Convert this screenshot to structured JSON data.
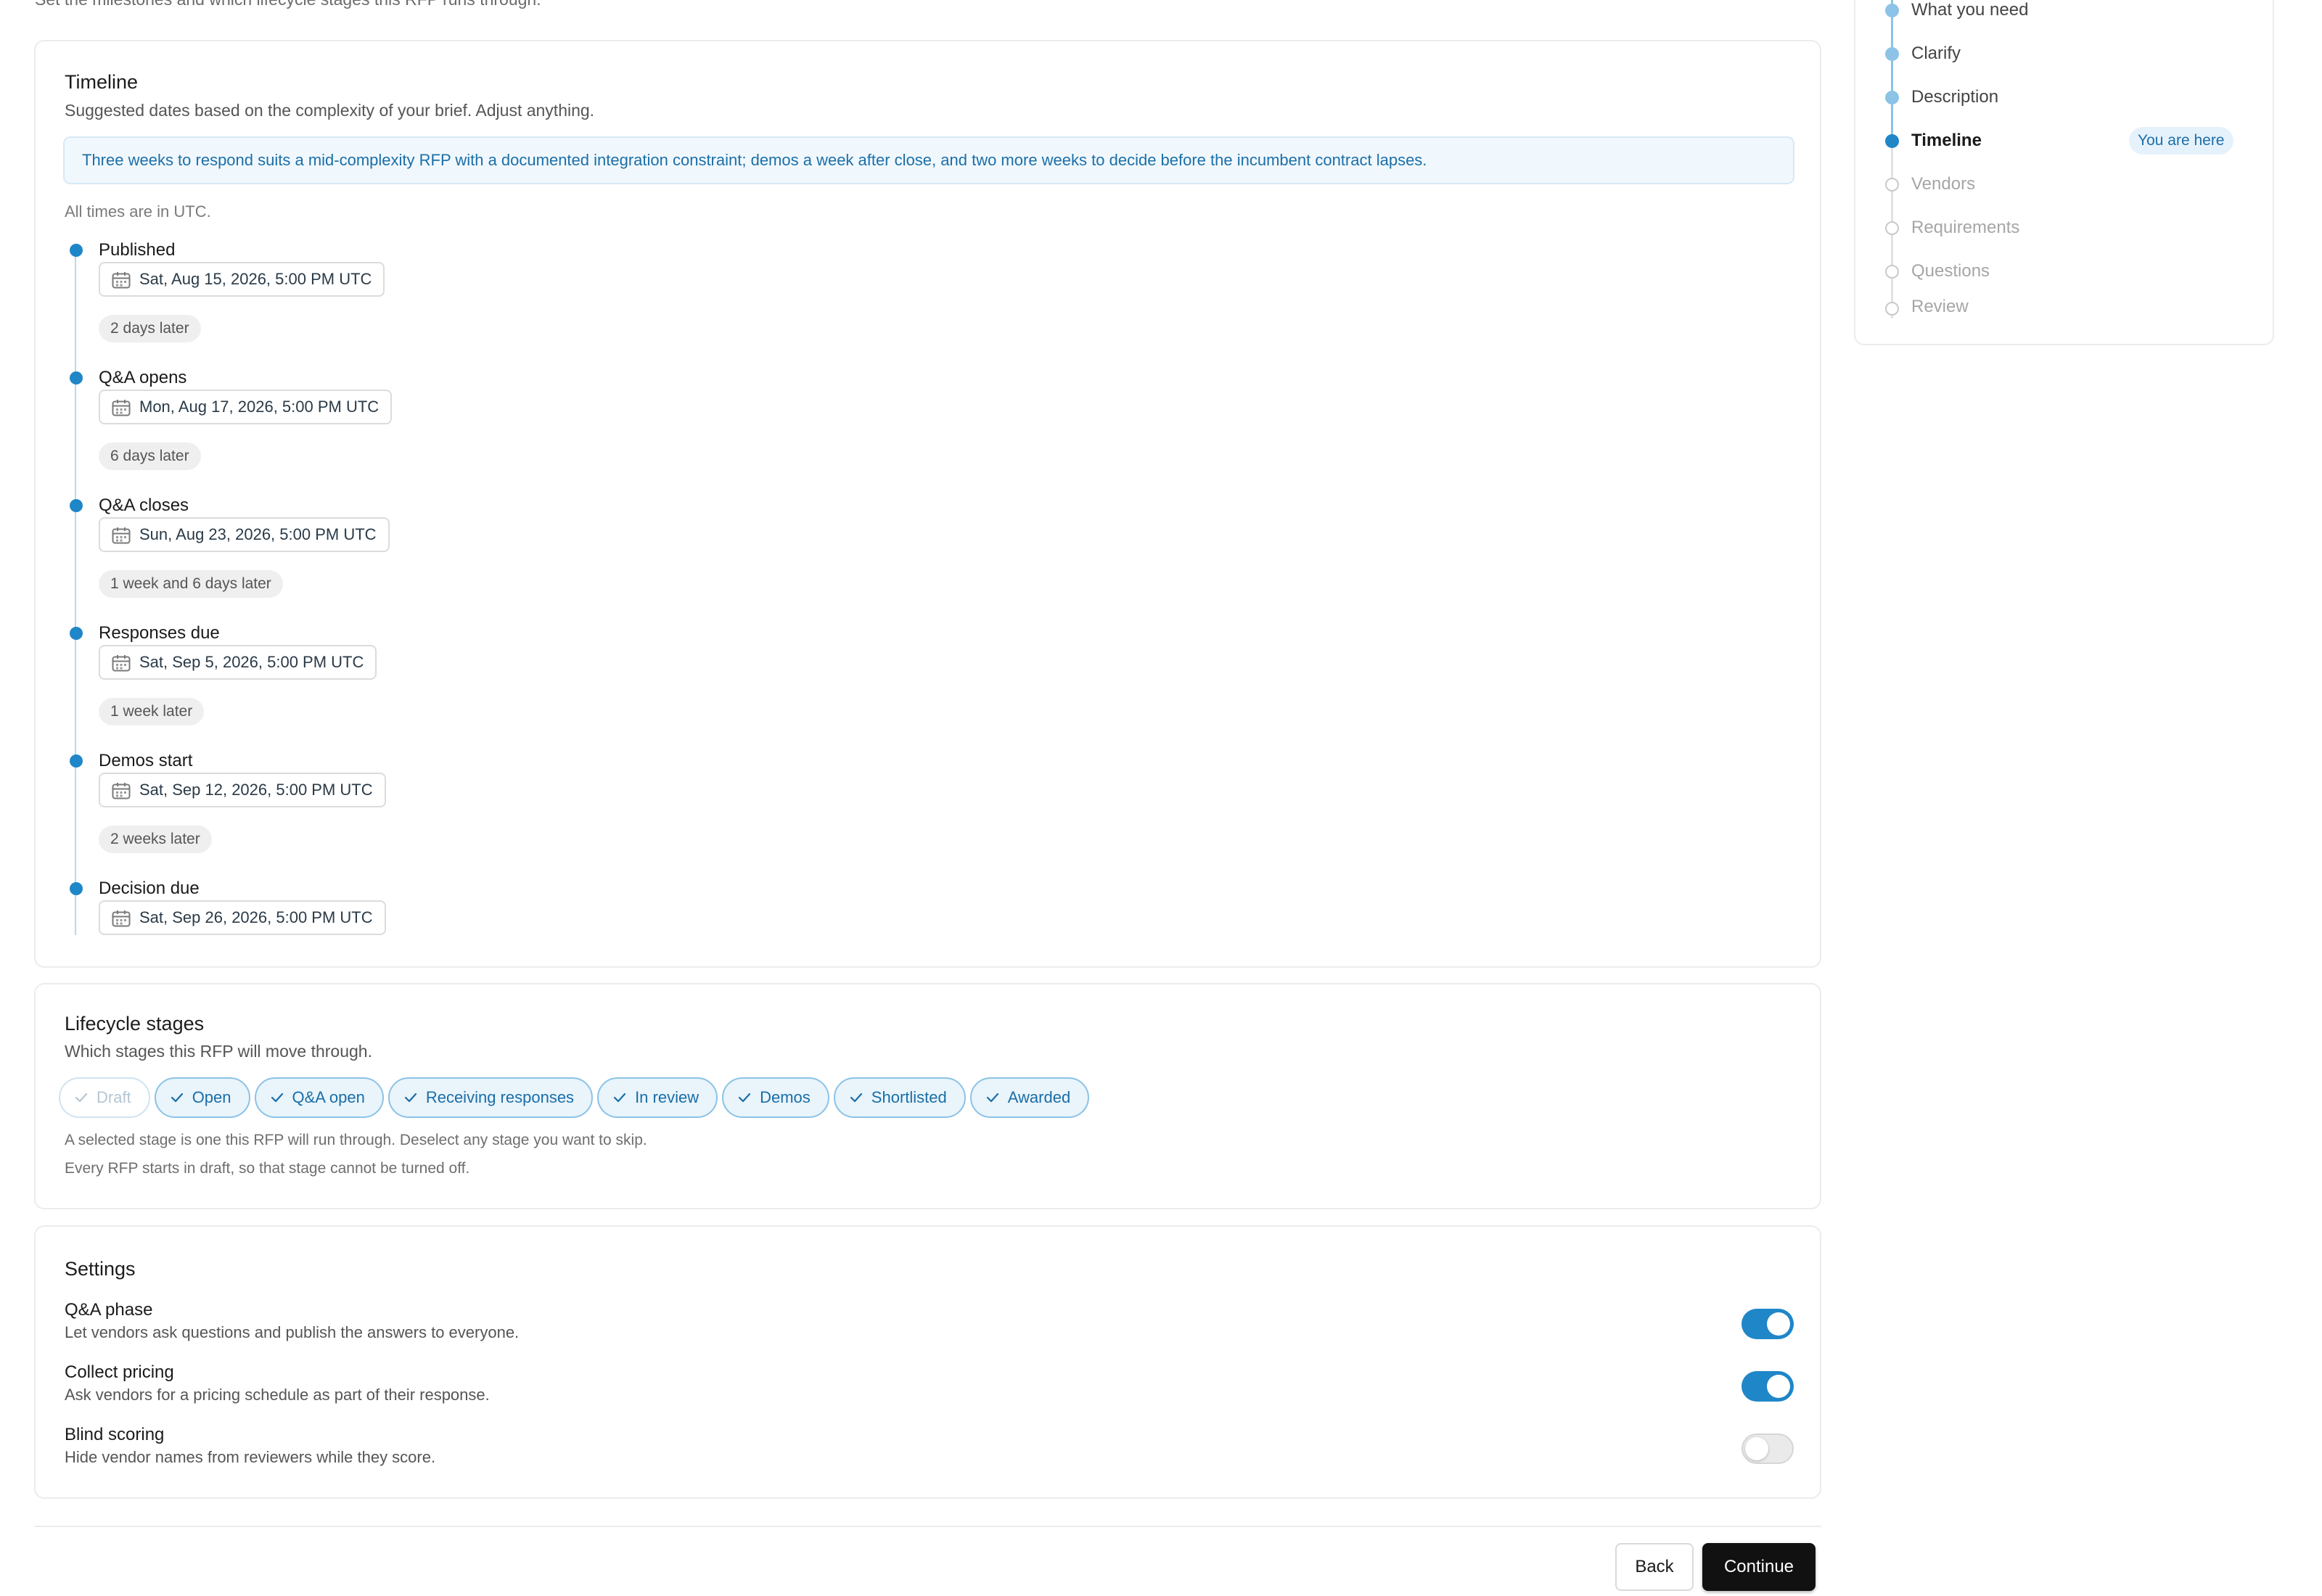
{
  "intro_text": "Set the milestones and which lifecycle stages this RFP runs through.",
  "timeline": {
    "title": "Timeline",
    "subtitle": "Suggested dates based on the complexity of your brief. Adjust anything.",
    "info": "Three weeks to respond suits a mid-complexity RFP with a documented integration constraint; demos a week after close, and two more weeks to decide before the incumbent contract lapses.",
    "utc_note": "All times are in UTC.",
    "milestones": [
      {
        "title": "Published",
        "date": "Sat, Aug 15, 2026, 5:00 PM UTC",
        "gap": "2 days later"
      },
      {
        "title": "Q&A opens",
        "date": "Mon, Aug 17, 2026, 5:00 PM UTC",
        "gap": "6 days later"
      },
      {
        "title": "Q&A closes",
        "date": "Sun, Aug 23, 2026, 5:00 PM UTC",
        "gap": "1 week and 6 days later"
      },
      {
        "title": "Responses due",
        "date": "Sat, Sep 5, 2026, 5:00 PM UTC",
        "gap": "1 week later"
      },
      {
        "title": "Demos start",
        "date": "Sat, Sep 12, 2026, 5:00 PM UTC",
        "gap": "2 weeks later"
      },
      {
        "title": "Decision due",
        "date": "Sat, Sep 26, 2026, 5:00 PM UTC",
        "gap": ""
      }
    ]
  },
  "lifecycle": {
    "title": "Lifecycle stages",
    "subtitle": "Which stages this RFP will move through.",
    "stages": [
      {
        "label": "Draft",
        "selected": true,
        "locked": true
      },
      {
        "label": "Open",
        "selected": true
      },
      {
        "label": "Q&A open",
        "selected": true
      },
      {
        "label": "Receiving responses",
        "selected": true
      },
      {
        "label": "In review",
        "selected": true
      },
      {
        "label": "Demos",
        "selected": true
      },
      {
        "label": "Shortlisted",
        "selected": true
      },
      {
        "label": "Awarded",
        "selected": true
      }
    ],
    "note1": "A selected stage is one this RFP will run through. Deselect any stage you want to skip.",
    "note2": "Every RFP starts in draft, so that stage cannot be turned off."
  },
  "settings": {
    "title": "Settings",
    "items": [
      {
        "label": "Q&A phase",
        "description": "Let vendors ask questions and publish the answers to everyone.",
        "enabled": true
      },
      {
        "label": "Collect pricing",
        "description": "Ask vendors for a pricing schedule as part of their response.",
        "enabled": true
      },
      {
        "label": "Blind scoring",
        "description": "Hide vendor names from reviewers while they score.",
        "enabled": false
      }
    ]
  },
  "actions": {
    "back_label": "Back",
    "continue_label": "Continue"
  },
  "stepper": {
    "current_badge": "You are here",
    "steps": [
      {
        "label": "What you need",
        "status": "done"
      },
      {
        "label": "Clarify",
        "status": "done"
      },
      {
        "label": "Description",
        "status": "done"
      },
      {
        "label": "Timeline",
        "status": "current"
      },
      {
        "label": "Vendors",
        "status": "todo"
      },
      {
        "label": "Requirements",
        "status": "todo"
      },
      {
        "label": "Questions",
        "status": "todo"
      },
      {
        "label": "Review",
        "status": "todo"
      }
    ]
  },
  "colors": {
    "accent": "#1f86c8",
    "accent_light": "#8cc3e6",
    "primary_button": "#111111"
  },
  "icons": {
    "date_field": "calendar-icon",
    "chip_check": "check-icon"
  }
}
